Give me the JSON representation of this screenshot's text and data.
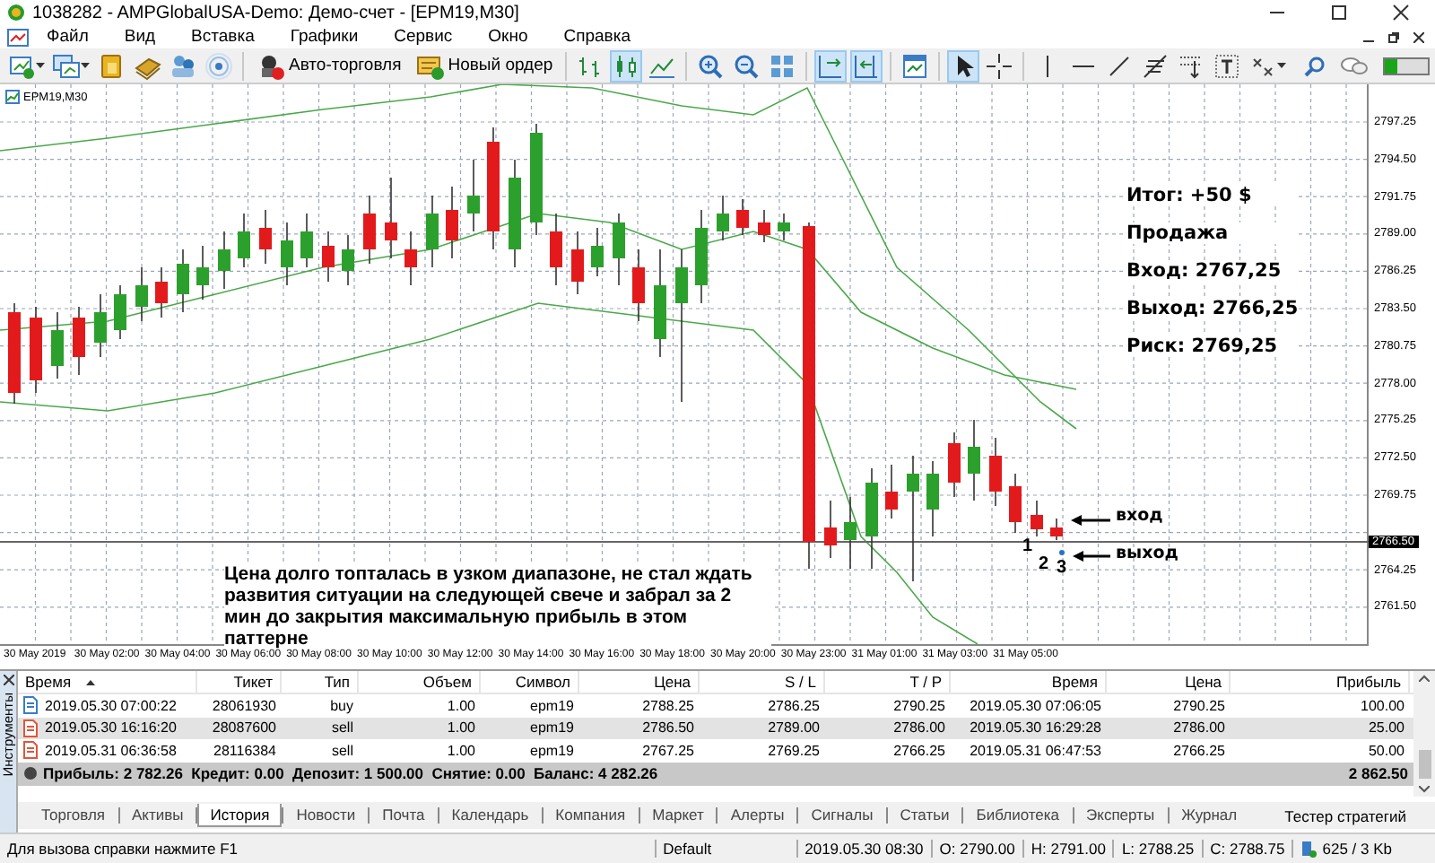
{
  "window": {
    "title": "1038282 - AMPGlobalUSA-Demo: Демо-счет - [EPM19,M30]"
  },
  "menu": [
    "Файл",
    "Вид",
    "Вставка",
    "Графики",
    "Сервис",
    "Окно",
    "Справка"
  ],
  "toolbar": {
    "tools": [
      {
        "pressed": false
      },
      {
        "pressed": false
      },
      {
        "pressed": false
      },
      {
        "pressed": false
      },
      {
        "pressed": false
      },
      {
        "pressed": false
      },
      {
        "pressed": false
      },
      {
        "pressed": true
      },
      {
        "pressed": false
      },
      {
        "pressed": false
      },
      {
        "pressed": false
      },
      {
        "pressed": false
      },
      {
        "pressed": true
      },
      {
        "pressed": true
      },
      {
        "pressed": false
      },
      {
        "pressed": true
      },
      {
        "pressed": false
      },
      {
        "pressed": false
      },
      {
        "pressed": false
      },
      {
        "pressed": false
      },
      {
        "pressed": false
      },
      {
        "pressed": false
      },
      {
        "pressed": false
      },
      {
        "pressed": false
      }
    ],
    "buttons": [
      {
        "kind": "autotrade",
        "label": "Авто-торговля"
      },
      {
        "kind": "order",
        "label": "Новый ордер"
      }
    ]
  },
  "chart": {
    "tab": "EPM19,M30",
    "price_labels": [
      "2797.25",
      "2794.50",
      "2791.75",
      "2789.00",
      "2786.25",
      "2783.50",
      "2780.75",
      "2778.00",
      "2775.25",
      "2772.50",
      "2769.75",
      "2764.25",
      "2761.50"
    ],
    "current_price": "2766.50",
    "time_labels": [
      "30 May 2019",
      "30 May 02:00",
      "30 May 04:00",
      "30 May 06:00",
      "30 May 08:00",
      "30 May 10:00",
      "30 May 12:00",
      "30 May 14:00",
      "30 May 16:00",
      "30 May 18:00",
      "30 May 20:00",
      "30 May 23:00",
      "31 May 01:00",
      "31 May 03:00",
      "31 May 05:00"
    ],
    "summary": [
      "Итог: +50 $",
      "Продажа",
      "Вход: 2767,25",
      "Выход: 2766,25",
      "Риск: 2769,25"
    ],
    "comment": "Цена долго топталась в узком диапазоне, не стал ждать развития ситуации на следующей свече и забрал за 2 мин до закрытия максимальную прибыль в этом паттерне",
    "markers": [
      "1",
      "2",
      "3"
    ],
    "arrows": [
      "вход",
      "выход"
    ]
  },
  "terminal": {
    "side_label": "Инструменты",
    "columns": [
      "Время",
      "Тикет",
      "Тип",
      "Объем",
      "Символ",
      "Цена",
      "S / L",
      "T / P",
      "Время",
      "Цена",
      "Прибыль"
    ],
    "rows": [
      {
        "kind": "buy",
        "selected": false,
        "cells": [
          "2019.05.30 07:00:22",
          "28061930",
          "buy",
          "1.00",
          "epm19",
          "2788.25",
          "2786.25",
          "2790.25",
          "2019.05.30 07:06:05",
          "2790.25",
          "100.00"
        ]
      },
      {
        "kind": "sell",
        "selected": true,
        "cells": [
          "2019.05.30 16:16:20",
          "28087600",
          "sell",
          "1.00",
          "epm19",
          "2786.50",
          "2789.00",
          "2786.00",
          "2019.05.30 16:29:28",
          "2786.00",
          "25.00"
        ]
      },
      {
        "kind": "sell",
        "selected": false,
        "cells": [
          "2019.05.31 06:36:58",
          "28116384",
          "sell",
          "1.00",
          "epm19",
          "2767.25",
          "2769.25",
          "2766.25",
          "2019.05.31 06:47:53",
          "2766.25",
          "50.00"
        ]
      }
    ],
    "summary": "Прибыль: 2 782.26  Кредит: 0.00  Депозит: 1 500.00  Снятие: 0.00  Баланс: 4 282.26",
    "total": "2 862.50",
    "tabs": [
      {
        "label": "Торговля",
        "selected": false
      },
      {
        "label": "Активы",
        "selected": false
      },
      {
        "label": "История",
        "selected": true
      },
      {
        "label": "Новости",
        "selected": false
      },
      {
        "label": "Почта",
        "selected": false
      },
      {
        "label": "Календарь",
        "selected": false
      },
      {
        "label": "Компания",
        "selected": false
      },
      {
        "label": "Маркет",
        "selected": false
      },
      {
        "label": "Алерты",
        "selected": false
      },
      {
        "label": "Сигналы",
        "selected": false
      },
      {
        "label": "Статьи",
        "selected": false
      },
      {
        "label": "Библиотека",
        "selected": false
      },
      {
        "label": "Эксперты",
        "selected": false
      },
      {
        "label": "Журнал",
        "selected": false
      }
    ],
    "tester": "Тестер стратегий"
  },
  "status_bar": {
    "help": "Для вызова справки нажмите F1",
    "profile": "Default",
    "fields": [
      "2019.05.30 08:30",
      "O: 2790.00",
      "H: 2791.00",
      "L: 2788.25",
      "C: 2788.75"
    ],
    "traffic": "625 / 3 Kb"
  }
}
